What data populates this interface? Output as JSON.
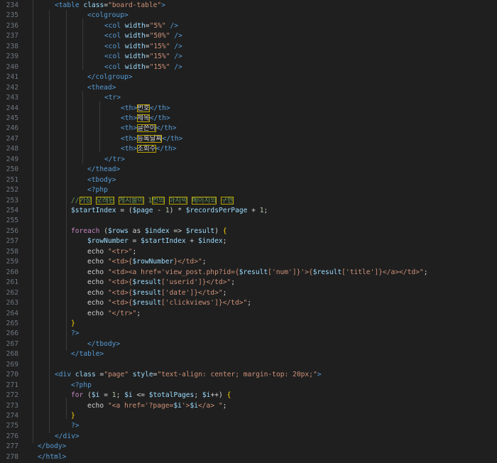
{
  "editor": {
    "lines": [
      {
        "num": "234",
        "indent": 1,
        "tokens": [
          [
            "tag",
            "<table "
          ],
          [
            "attr",
            "class"
          ],
          [
            "punc",
            "="
          ],
          [
            "str",
            "\"board-table\""
          ],
          [
            "tag",
            ">"
          ]
        ]
      },
      {
        "num": "235",
        "indent": 3,
        "tokens": [
          [
            "tag",
            "<colgroup>"
          ]
        ]
      },
      {
        "num": "236",
        "indent": 4,
        "tokens": [
          [
            "tag",
            "<col "
          ],
          [
            "attr",
            "width"
          ],
          [
            "punc",
            "="
          ],
          [
            "str",
            "\"5%\""
          ],
          [
            "tag",
            " />"
          ]
        ]
      },
      {
        "num": "237",
        "indent": 4,
        "tokens": [
          [
            "tag",
            "<col "
          ],
          [
            "attr",
            "width"
          ],
          [
            "punc",
            "="
          ],
          [
            "str",
            "\"50%\""
          ],
          [
            "tag",
            " />"
          ]
        ]
      },
      {
        "num": "238",
        "indent": 4,
        "tokens": [
          [
            "tag",
            "<col "
          ],
          [
            "attr",
            "width"
          ],
          [
            "punc",
            "="
          ],
          [
            "str",
            "\"15%\""
          ],
          [
            "tag",
            " />"
          ]
        ]
      },
      {
        "num": "239",
        "indent": 4,
        "tokens": [
          [
            "tag",
            "<col "
          ],
          [
            "attr",
            "width"
          ],
          [
            "punc",
            "="
          ],
          [
            "str",
            "\"15%\""
          ],
          [
            "tag",
            " />"
          ]
        ]
      },
      {
        "num": "240",
        "indent": 4,
        "tokens": [
          [
            "tag",
            "<col "
          ],
          [
            "attr",
            "width"
          ],
          [
            "punc",
            "="
          ],
          [
            "str",
            "\"15%\""
          ],
          [
            "tag",
            " />"
          ]
        ]
      },
      {
        "num": "241",
        "indent": 3,
        "tokens": [
          [
            "tag",
            "</colgroup>"
          ]
        ]
      },
      {
        "num": "242",
        "indent": 3,
        "tokens": [
          [
            "tag",
            "<thead>"
          ]
        ]
      },
      {
        "num": "243",
        "indent": 4,
        "tokens": [
          [
            "tag",
            "<tr>"
          ]
        ]
      },
      {
        "num": "244",
        "indent": 5,
        "tokens": [
          [
            "tag",
            "<th>"
          ],
          [
            "texthl",
            "번호"
          ],
          [
            "tag",
            "</th>"
          ]
        ]
      },
      {
        "num": "245",
        "indent": 5,
        "tokens": [
          [
            "tag",
            "<th>"
          ],
          [
            "texthl",
            "제목"
          ],
          [
            "tag",
            "</th>"
          ]
        ]
      },
      {
        "num": "246",
        "indent": 5,
        "tokens": [
          [
            "tag",
            "<th>"
          ],
          [
            "texthl",
            "글쓴이"
          ],
          [
            "tag",
            "</th>"
          ]
        ]
      },
      {
        "num": "247",
        "indent": 5,
        "tokens": [
          [
            "tag",
            "<th>"
          ],
          [
            "texthl",
            "등록날짜"
          ],
          [
            "tag",
            "</th>"
          ]
        ]
      },
      {
        "num": "248",
        "indent": 5,
        "tokens": [
          [
            "tag",
            "<th>"
          ],
          [
            "texthl",
            "조회수"
          ],
          [
            "tag",
            "</th>"
          ]
        ]
      },
      {
        "num": "249",
        "indent": 4,
        "tokens": [
          [
            "tag",
            "</tr>"
          ]
        ]
      },
      {
        "num": "250",
        "indent": 3,
        "tokens": [
          [
            "tag",
            "</thead>"
          ]
        ]
      },
      {
        "num": "251",
        "indent": 3,
        "tokens": [
          [
            "tag",
            "<tbody>"
          ]
        ]
      },
      {
        "num": "252",
        "indent": 3,
        "tokens": [
          [
            "php",
            "<?php"
          ]
        ]
      },
      {
        "num": "253",
        "indent": 2,
        "tokens": [
          [
            "com",
            "//"
          ],
          [
            "comhl",
            "가장"
          ],
          [
            "com",
            " "
          ],
          [
            "comhl",
            "오래된"
          ],
          [
            "com",
            " "
          ],
          [
            "comhl",
            "게시물이"
          ],
          [
            "com",
            " 1"
          ],
          [
            "comhl",
            "번의"
          ],
          [
            "com",
            " "
          ],
          [
            "comhl",
            "마지막"
          ],
          [
            "com",
            " "
          ],
          [
            "comhl",
            "페이지의"
          ],
          [
            "com",
            " "
          ],
          [
            "comhl",
            "구현"
          ]
        ]
      },
      {
        "num": "254",
        "indent": 2,
        "tokens": [
          [
            "var",
            "$startIndex"
          ],
          [
            "punc",
            " = ("
          ],
          [
            "var",
            "$page"
          ],
          [
            "punc",
            " - "
          ],
          [
            "num",
            "1"
          ],
          [
            "punc",
            ") * "
          ],
          [
            "var",
            "$recordsPerPage"
          ],
          [
            "punc",
            " + "
          ],
          [
            "num",
            "1"
          ],
          [
            "punc",
            ";"
          ]
        ]
      },
      {
        "num": "255",
        "indent": 0,
        "tokens": []
      },
      {
        "num": "256",
        "indent": 2,
        "tokens": [
          [
            "kw",
            "foreach"
          ],
          [
            "punc",
            " ("
          ],
          [
            "var",
            "$rows"
          ],
          [
            "punc",
            " as "
          ],
          [
            "var",
            "$index"
          ],
          [
            "punc",
            " => "
          ],
          [
            "var",
            "$result"
          ],
          [
            "punc",
            ") "
          ],
          [
            "brace",
            "{"
          ]
        ]
      },
      {
        "num": "257",
        "indent": 3,
        "tokens": [
          [
            "var",
            "$rowNumber"
          ],
          [
            "punc",
            " = "
          ],
          [
            "var",
            "$startIndex"
          ],
          [
            "punc",
            " + "
          ],
          [
            "var",
            "$index"
          ],
          [
            "punc",
            ";"
          ]
        ]
      },
      {
        "num": "258",
        "indent": 3,
        "tokens": [
          [
            "punc",
            "echo "
          ],
          [
            "str",
            "\"<tr>\""
          ],
          [
            "punc",
            ";"
          ]
        ]
      },
      {
        "num": "259",
        "indent": 3,
        "tokens": [
          [
            "punc",
            "echo "
          ],
          [
            "str",
            "\"<td>{"
          ],
          [
            "var",
            "$rowNumber"
          ],
          [
            "str",
            "}</td>\""
          ],
          [
            "punc",
            ";"
          ]
        ]
      },
      {
        "num": "260",
        "indent": 3,
        "tokens": [
          [
            "punc",
            "echo "
          ],
          [
            "str",
            "\"<td><a href='view_post.php?id={"
          ],
          [
            "var",
            "$result"
          ],
          [
            "str",
            "['num']}'>{"
          ],
          [
            "var",
            "$result"
          ],
          [
            "str",
            "['title']}</a></td>\""
          ],
          [
            "punc",
            ";"
          ]
        ]
      },
      {
        "num": "261",
        "indent": 3,
        "tokens": [
          [
            "punc",
            "echo "
          ],
          [
            "str",
            "\"<td>{"
          ],
          [
            "var",
            "$result"
          ],
          [
            "str",
            "['userid']}</td>\""
          ],
          [
            "punc",
            ";"
          ]
        ]
      },
      {
        "num": "262",
        "indent": 3,
        "tokens": [
          [
            "punc",
            "echo "
          ],
          [
            "str",
            "\"<td>{"
          ],
          [
            "var",
            "$result"
          ],
          [
            "str",
            "['date']}</td>\""
          ],
          [
            "punc",
            ";"
          ]
        ]
      },
      {
        "num": "263",
        "indent": 3,
        "tokens": [
          [
            "punc",
            "echo "
          ],
          [
            "str",
            "\"<td>{"
          ],
          [
            "var",
            "$result"
          ],
          [
            "str",
            "['clickviews']}</td>\""
          ],
          [
            "punc",
            ";"
          ]
        ]
      },
      {
        "num": "264",
        "indent": 3,
        "tokens": [
          [
            "punc",
            "echo "
          ],
          [
            "str",
            "\"</tr>\""
          ],
          [
            "punc",
            ";"
          ]
        ]
      },
      {
        "num": "265",
        "indent": 2,
        "tokens": [
          [
            "brace",
            "}"
          ]
        ]
      },
      {
        "num": "266",
        "indent": 2,
        "tokens": [
          [
            "php",
            "?>"
          ]
        ]
      },
      {
        "num": "267",
        "indent": 3,
        "tokens": [
          [
            "tag",
            "</tbody>"
          ]
        ]
      },
      {
        "num": "268",
        "indent": 2,
        "tokens": [
          [
            "tag",
            "</table>"
          ]
        ]
      },
      {
        "num": "269",
        "indent": 0,
        "tokens": []
      },
      {
        "num": "270",
        "indent": 1,
        "tokens": [
          [
            "tag",
            "<div "
          ],
          [
            "attr",
            "class"
          ],
          [
            "punc",
            " ="
          ],
          [
            "str",
            "\"page\""
          ],
          [
            "punc",
            " "
          ],
          [
            "attr",
            "style"
          ],
          [
            "punc",
            "="
          ],
          [
            "str",
            "\"text-align: center; margin-top: 20px;\""
          ],
          [
            "tag",
            ">"
          ]
        ]
      },
      {
        "num": "271",
        "indent": 2,
        "tokens": [
          [
            "php",
            "<?php"
          ]
        ]
      },
      {
        "num": "272",
        "indent": 2,
        "tokens": [
          [
            "kw",
            "for"
          ],
          [
            "punc",
            " ("
          ],
          [
            "var",
            "$i"
          ],
          [
            "punc",
            " = "
          ],
          [
            "num",
            "1"
          ],
          [
            "punc",
            "; "
          ],
          [
            "var",
            "$i"
          ],
          [
            "punc",
            " <= "
          ],
          [
            "var",
            "$totalPages"
          ],
          [
            "punc",
            "; "
          ],
          [
            "var",
            "$i"
          ],
          [
            "punc",
            "++) "
          ],
          [
            "brace",
            "{"
          ]
        ]
      },
      {
        "num": "273",
        "indent": 3,
        "tokens": [
          [
            "punc",
            "echo "
          ],
          [
            "str",
            "\"<a href='?page="
          ],
          [
            "var",
            "$i"
          ],
          [
            "str",
            "'>"
          ],
          [
            "var",
            "$i"
          ],
          [
            "str",
            "</a> \""
          ],
          [
            "punc",
            ";"
          ]
        ]
      },
      {
        "num": "274",
        "indent": 2,
        "tokens": [
          [
            "brace",
            "}"
          ]
        ]
      },
      {
        "num": "275",
        "indent": 2,
        "tokens": [
          [
            "php",
            "?>"
          ]
        ]
      },
      {
        "num": "276",
        "indent": 1,
        "tokens": [
          [
            "tag",
            "</div>"
          ]
        ]
      },
      {
        "num": "277",
        "indent": 0,
        "tokens": [
          [
            "tag",
            "</body>"
          ]
        ]
      },
      {
        "num": "278",
        "indent": 0,
        "tokens": [
          [
            "tag",
            "</html>"
          ]
        ]
      }
    ]
  }
}
